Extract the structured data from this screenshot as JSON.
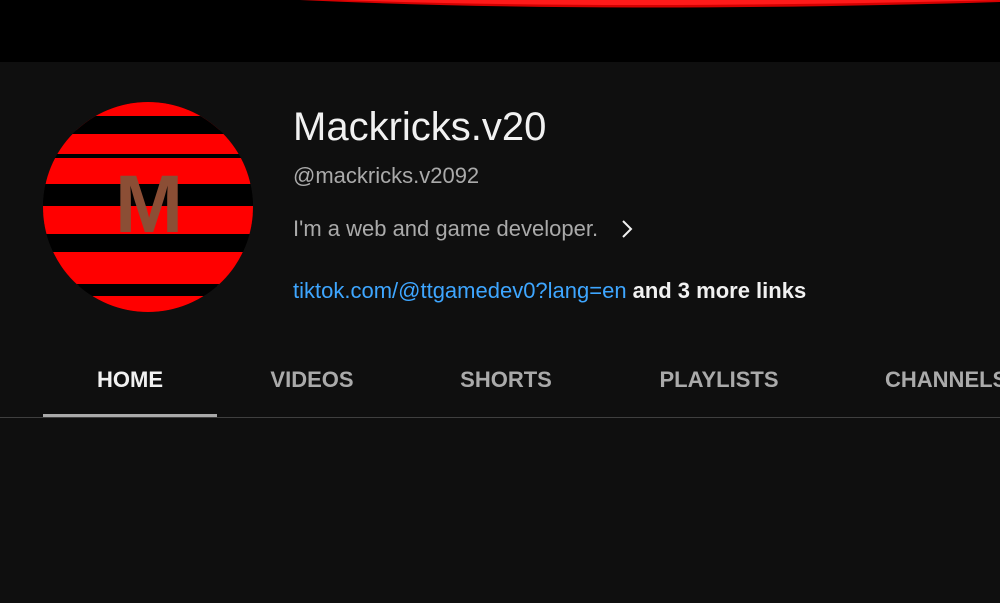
{
  "channel": {
    "name": "Mackricks.v20",
    "handle": "@mackricks.v2092",
    "description": "I'm a web and game developer.",
    "avatar_letter": "M",
    "avatar_colors": {
      "stripe_red": "#ff0000",
      "stripe_black": "#000000",
      "letter": "#8b4e35"
    }
  },
  "links": {
    "primary": "tiktok.com/@ttgamedev0?lang=en",
    "more": "and 3 more links"
  },
  "tabs": [
    {
      "label": "HOME",
      "active": true
    },
    {
      "label": "VIDEOS",
      "active": false
    },
    {
      "label": "SHORTS",
      "active": false
    },
    {
      "label": "PLAYLISTS",
      "active": false
    },
    {
      "label": "CHANNELS",
      "active": false
    }
  ],
  "icons": {
    "description_expand": "chevron-right-icon"
  },
  "colors": {
    "background": "#0f0f0f",
    "link": "#3ea6ff",
    "primary_text": "#f1f1f1",
    "secondary_text": "#aaaaaa"
  }
}
